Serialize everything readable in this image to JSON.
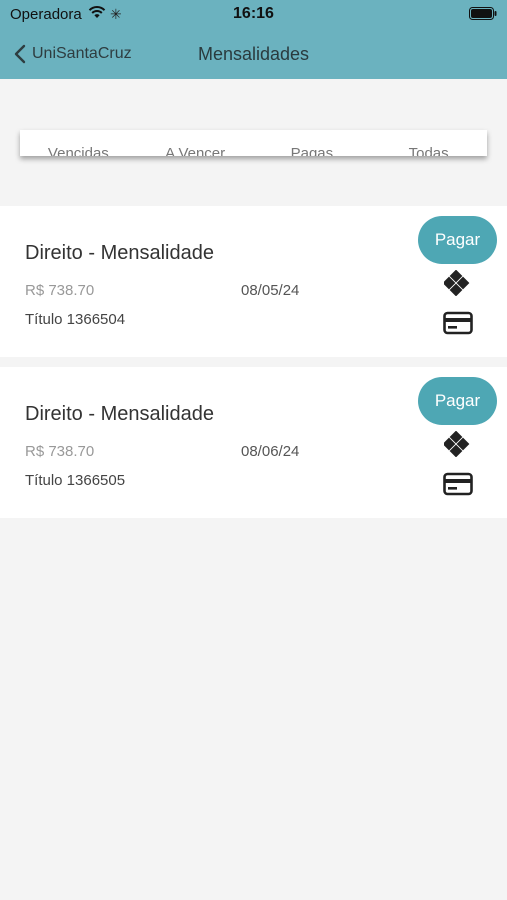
{
  "status_bar": {
    "carrier": "Operadora",
    "time": "16:16"
  },
  "nav": {
    "back_label": "UniSantaCruz",
    "title": "Mensalidades"
  },
  "tabs": [
    "Vencidas",
    "A Vencer",
    "Pagas",
    "Todas"
  ],
  "invoices": [
    {
      "title": "Direito - Mensalidade",
      "amount": "R$ 738.70",
      "due_date": "08/05/24",
      "number": "Título 1366504",
      "pay_label": "Pagar"
    },
    {
      "title": "Direito - Mensalidade",
      "amount": "R$ 738.70",
      "due_date": "08/06/24",
      "number": "Título 1366505",
      "pay_label": "Pagar"
    }
  ],
  "colors": {
    "header": "#6bb2bf",
    "accent": "#4ea7b4",
    "background": "#f4f4f4"
  },
  "icons": {
    "wifi": "wifi-icon",
    "loading": "spinner-icon",
    "battery": "battery-icon",
    "back": "chevron-left-icon",
    "pix": "pix-icon",
    "card": "credit-card-icon"
  }
}
